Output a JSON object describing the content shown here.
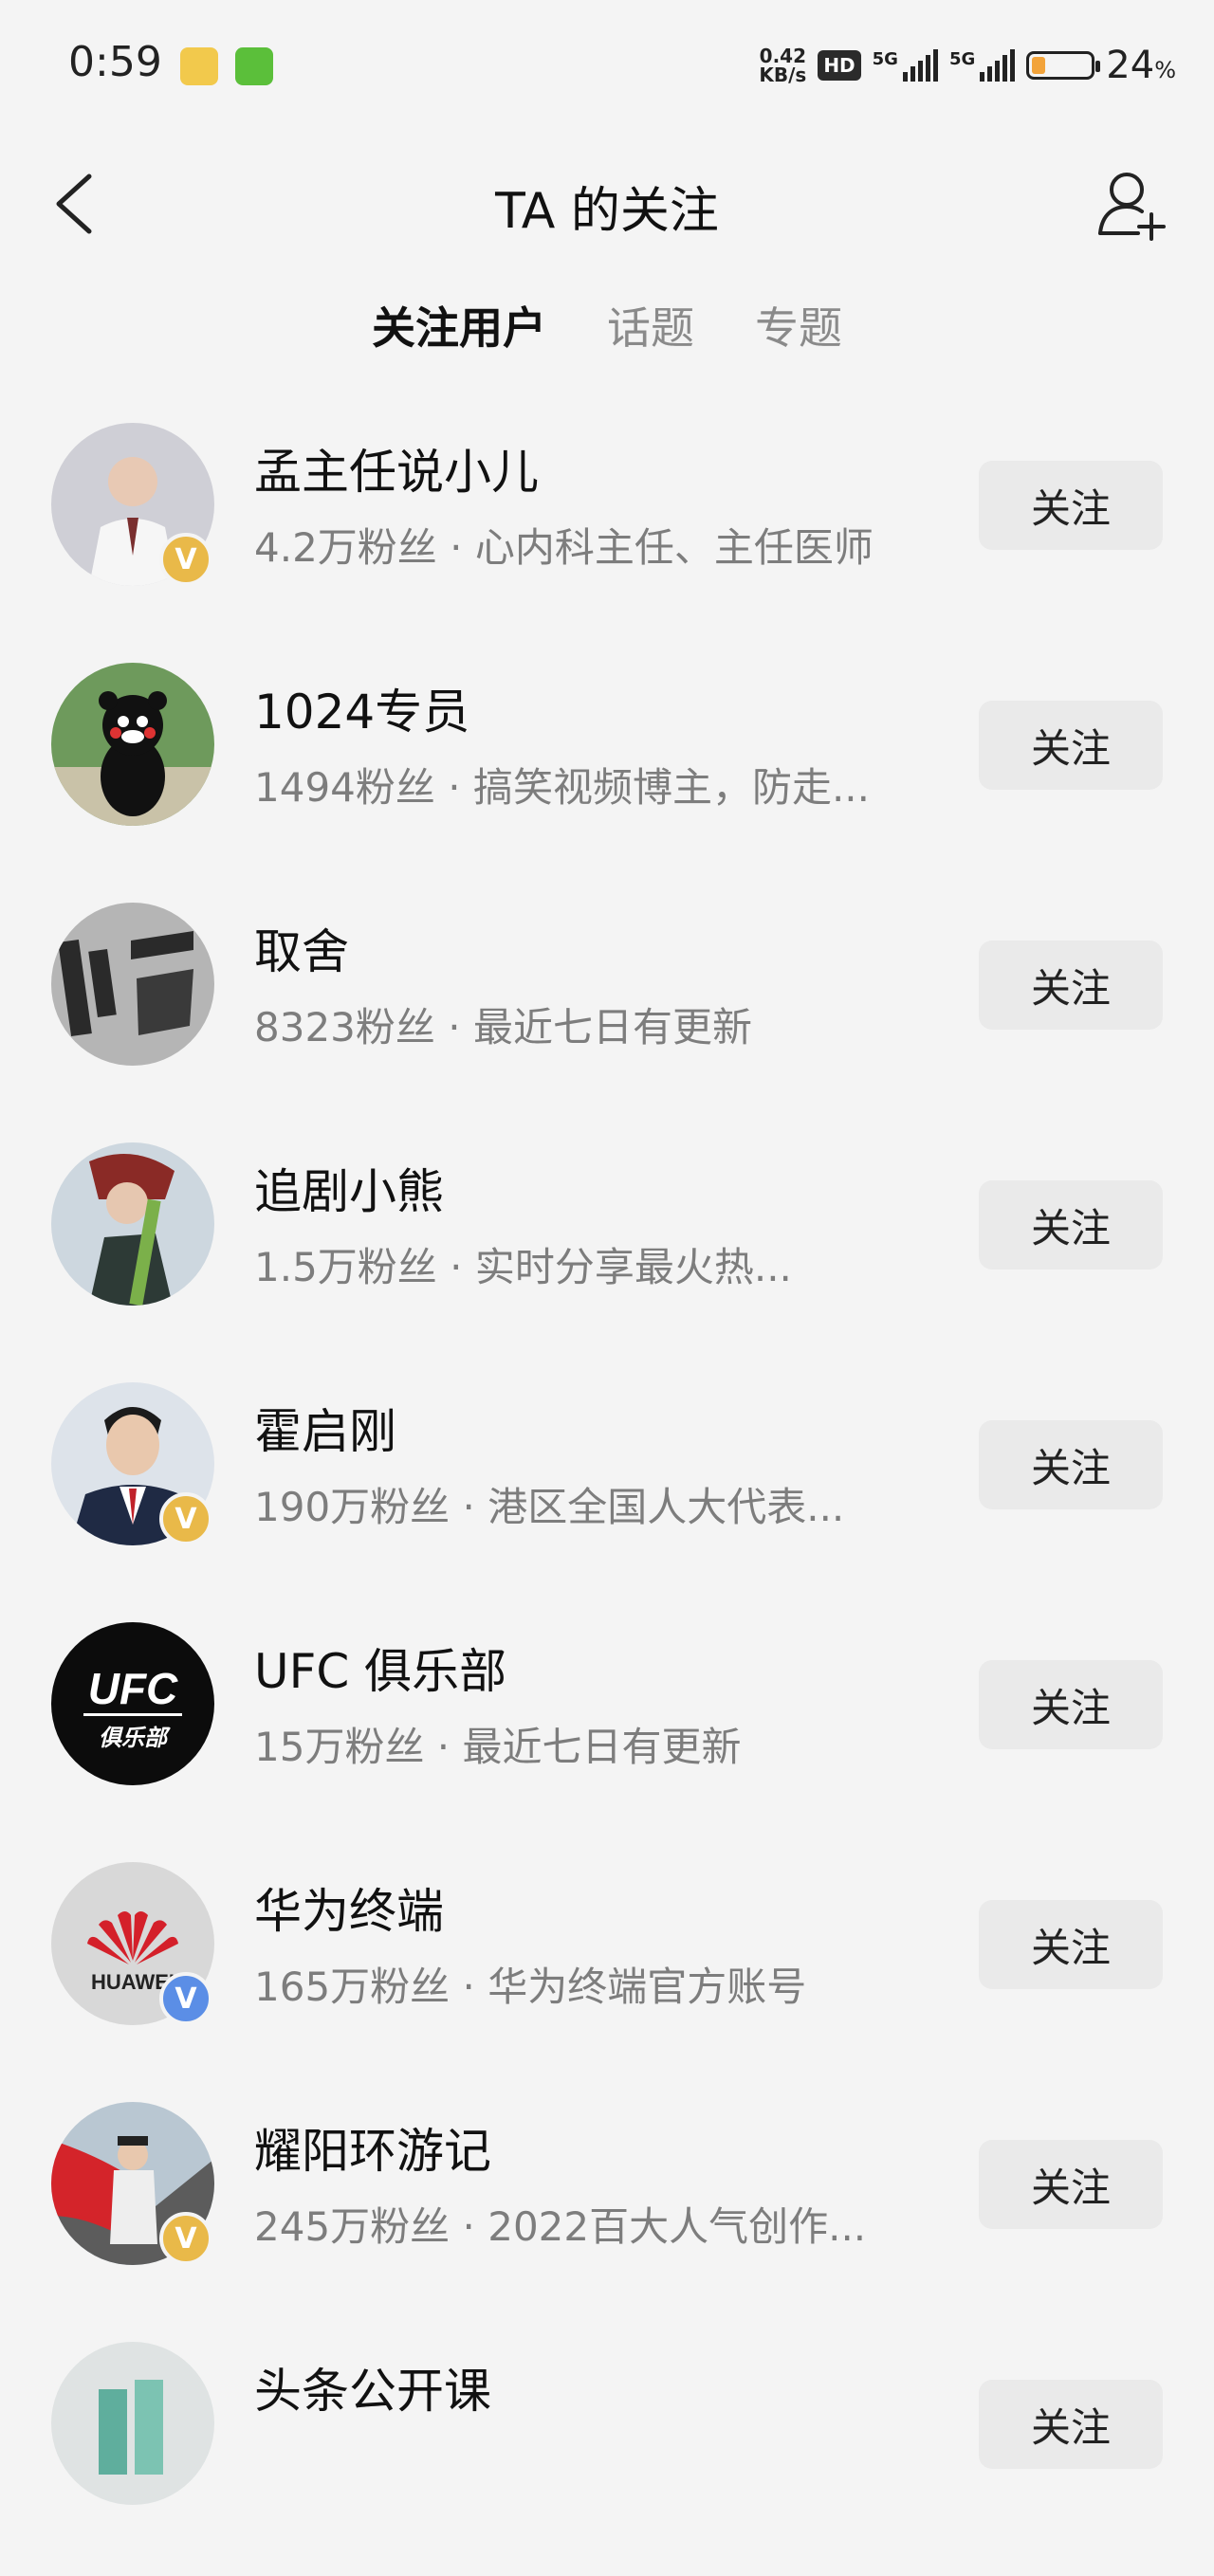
{
  "status_bar": {
    "time": "0:59",
    "net_speed_value": "0.42",
    "net_speed_unit": "KB/s",
    "hd_label": "HD",
    "signal1_label": "5G",
    "signal2_label": "5G",
    "battery_percent": "24",
    "battery_unit": "%",
    "battery_level": 0.24
  },
  "header": {
    "title": "TA 的关注"
  },
  "tabs": [
    {
      "label": "关注用户",
      "active": true
    },
    {
      "label": "话题",
      "active": false
    },
    {
      "label": "专题",
      "active": false
    }
  ],
  "users": [
    {
      "name": "孟主任说小儿",
      "desc": "4.2万粉丝 · 心内科主任、主任医师",
      "verified": "gold",
      "avatar_icon": "doctor-avatar",
      "follow_label": "关注"
    },
    {
      "name": "1024专员",
      "desc": "1494粉丝 · 搞笑视频博主，防走...",
      "verified": "",
      "avatar_icon": "bear-avatar",
      "follow_label": "关注"
    },
    {
      "name": "取舍",
      "desc": "8323粉丝 · 最近七日有更新",
      "verified": "",
      "avatar_icon": "calligraphy-avatar",
      "follow_label": "关注"
    },
    {
      "name": "追剧小熊",
      "desc": "1.5万粉丝 · 实时分享最火热...",
      "verified": "",
      "avatar_icon": "girl-avatar",
      "follow_label": "关注"
    },
    {
      "name": "霍启刚",
      "desc": "190万粉丝 · 港区全国人大代表...",
      "verified": "gold",
      "avatar_icon": "man-suit-avatar",
      "follow_label": "关注"
    },
    {
      "name": "UFC 俱乐部",
      "desc": "15万粉丝 · 最近七日有更新",
      "verified": "",
      "avatar_icon": "ufc-logo-avatar",
      "avatar_text_1": "UFC",
      "avatar_text_2": "俱乐部",
      "follow_label": "关注"
    },
    {
      "name": "华为终端",
      "desc": "165万粉丝 · 华为终端官方账号",
      "verified": "blue",
      "avatar_icon": "huawei-logo-avatar",
      "avatar_text_1": "HUAWEI",
      "follow_label": "关注"
    },
    {
      "name": "耀阳环游记",
      "desc": "245万粉丝 · 2022百大人气创作...",
      "verified": "gold",
      "avatar_icon": "flag-avatar",
      "follow_label": "关注"
    },
    {
      "name": "头条公开课",
      "desc": "",
      "verified": "",
      "avatar_icon": "building-avatar",
      "follow_label": "关注"
    }
  ],
  "badge_letter": "V"
}
